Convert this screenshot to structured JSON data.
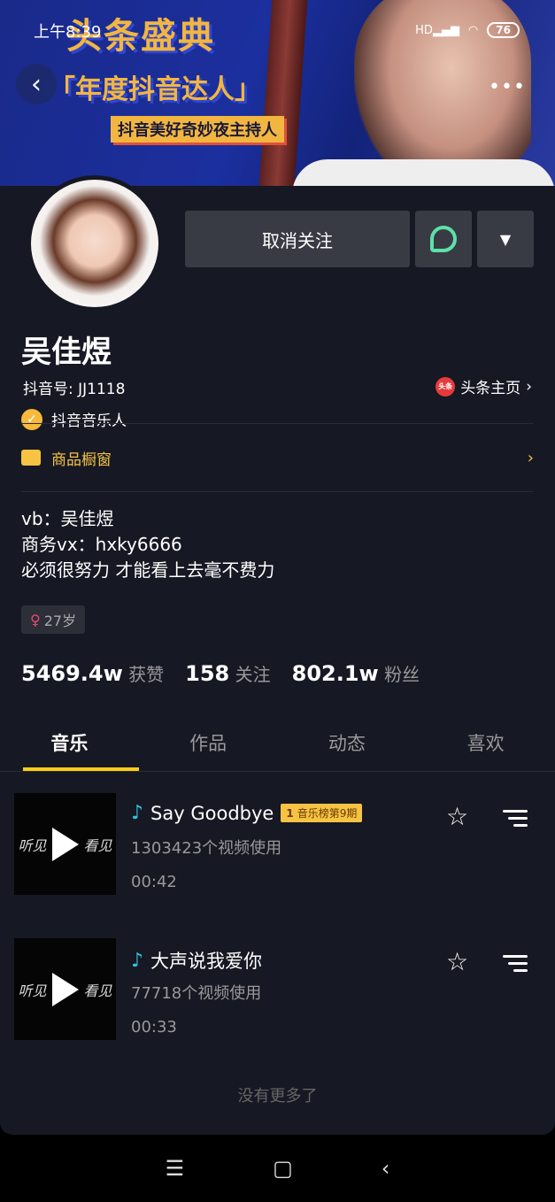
{
  "status_bar": {
    "time": "上午8:39",
    "network": "HD",
    "battery": "76"
  },
  "banner": {
    "line1": "头条盛典",
    "line2": "「年度抖音达人」",
    "line3": "抖音美好奇妙夜主持人"
  },
  "header": {
    "back": "‹",
    "more": "•••"
  },
  "profile": {
    "unfollow_label": "取消关注",
    "dropdown": "▼",
    "name": "吴佳煜",
    "douyin_id": "抖音号: JJ1118",
    "toutiao_label": "头条主页",
    "toutiao_logo": "头条",
    "verified": "抖音音乐人",
    "shop_label": "商品橱窗",
    "bio": [
      "vb：吴佳煜",
      "商务vx：hxky6666",
      "必须很努力 才能看上去毫不费力"
    ],
    "age": "27岁"
  },
  "stats": [
    {
      "value": "5469.4w",
      "label": "获赞"
    },
    {
      "value": "158",
      "label": "关注"
    },
    {
      "value": "802.1w",
      "label": "粉丝"
    }
  ],
  "tabs": [
    {
      "label": "音乐",
      "active": true
    },
    {
      "label": "作品"
    },
    {
      "label": "动态"
    },
    {
      "label": "喜欢"
    }
  ],
  "songs": [
    {
      "title": "Say Goodbye",
      "badge_rank": "1",
      "badge": "音乐榜第9期",
      "usage": "1303423个视频使用",
      "duration": "00:42",
      "cover_left": "听见",
      "cover_right": "看见"
    },
    {
      "title": "大声说我爱你",
      "usage": "77718个视频使用",
      "duration": "00:33",
      "cover_left": "听见",
      "cover_right": "看见"
    }
  ],
  "no_more": "没有更多了",
  "colors": {
    "background": "#161823",
    "accent": "#face15",
    "verified": "#f6b93b"
  }
}
